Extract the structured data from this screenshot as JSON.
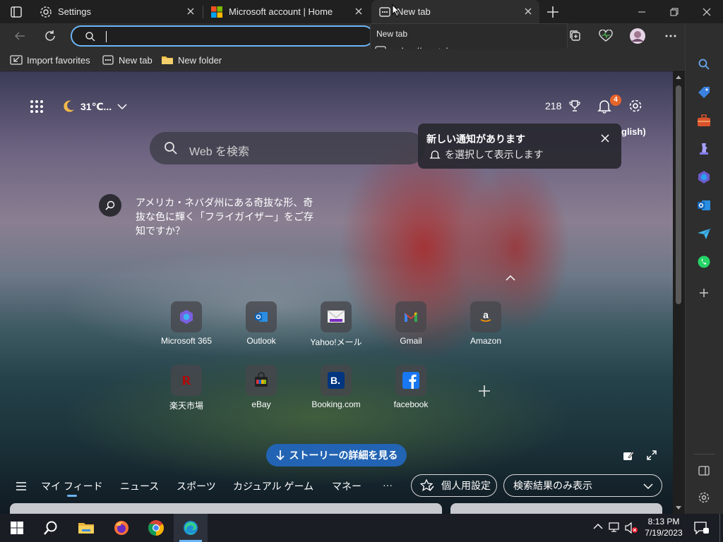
{
  "browser": {
    "tabs": [
      {
        "title": "Settings",
        "icon": "gear-icon"
      },
      {
        "title": "Microsoft account | Home",
        "icon": "microsoft-logo-icon"
      },
      {
        "title": "New tab",
        "icon": "newtab-page-icon",
        "active": true
      }
    ],
    "address_placeholder": "",
    "autocomplete": {
      "title": "New tab",
      "suggestion": "edge://newtab"
    },
    "favorites": [
      {
        "label": "Import favorites",
        "icon": "import-icon"
      },
      {
        "label": "New tab",
        "icon": "newtab-page-icon"
      },
      {
        "label": "New folder",
        "icon": "folder-icon"
      }
    ]
  },
  "newtab": {
    "weather": "31℃...",
    "rewards_points": "218",
    "notification_count": "4",
    "search_placeholder": "Web を検索",
    "notification_popup": {
      "title": "新しい通知があります",
      "subtitle": "を選択して表示します"
    },
    "language_fragment": "glish)",
    "fact_text": "アメリカ・ネバダ州にある奇抜な形、奇抜な色に輝く「フライガイザー」をご存知ですか？",
    "quick_links": [
      {
        "label": "Microsoft 365"
      },
      {
        "label": "Outlook"
      },
      {
        "label": "Yahoo!メール"
      },
      {
        "label": "Gmail"
      },
      {
        "label": "Amazon"
      },
      {
        "label": "楽天市場"
      },
      {
        "label": "eBay"
      },
      {
        "label": "Booking.com"
      },
      {
        "label": "facebook"
      }
    ],
    "stories_button": "ストーリーの詳細を見る",
    "feed_nav": [
      "マイ フィード",
      "ニュース",
      "スポーツ",
      "カジュアル ゲーム",
      "マネー",
      "···"
    ],
    "personalize_button": "個人用設定",
    "filter_select": "検索結果のみ表示"
  },
  "taskbar": {
    "time": "8:13 PM",
    "date": "7/19/2023"
  },
  "colors": {
    "accent_blue": "#2264b3",
    "address_focus": "#6ab5f5",
    "badge_orange": "#e8652a"
  }
}
